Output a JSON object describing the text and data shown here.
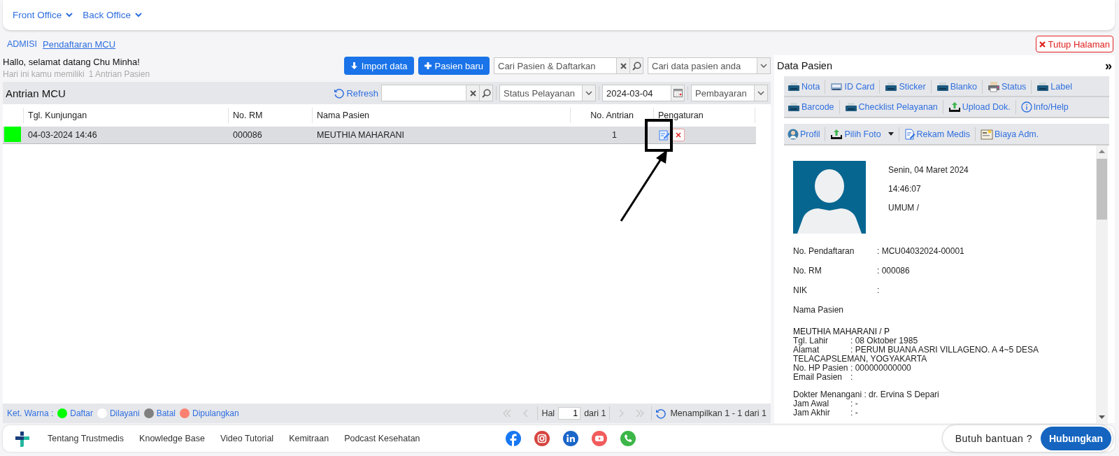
{
  "top_nav": [
    {
      "label": "Front Office"
    },
    {
      "label": "Back Office"
    }
  ],
  "breadcrumb": [
    {
      "label": "ADMISI",
      "selected": false
    },
    {
      "label": "Pendaftaran MCU",
      "selected": true
    }
  ],
  "close_button": "Tutup Halaman",
  "greeting": "Hallo, selamat datang Chu Minha!",
  "queue_summary": {
    "text": "Hari ini kamu memiliki",
    "count": "1 Antrian Pasien"
  },
  "actions": [
    {
      "label": "Import data",
      "kind": "import"
    },
    {
      "label": "Pasien baru",
      "kind": "add"
    }
  ],
  "register_search": {
    "placeholder": "Cari Pasien & Daftarkan"
  },
  "patient_search": {
    "placeholder": "Cari data pasien anda"
  },
  "queue": {
    "title": "Antrian MCU",
    "refresh": "Refresh",
    "status_select": {
      "placeholder": "Status Pelayanan"
    },
    "date": {
      "value": "2024-03-04"
    },
    "payment_select": {
      "placeholder": "Pembayaran"
    },
    "columns": [
      "Tgl. Kunjungan",
      "No. RM",
      "Nama Pasien",
      "No. Antrian",
      "Pengaturan"
    ],
    "rows": [
      {
        "color": "#00ff00",
        "selected": true,
        "cells": [
          "04-03-2024 14:46",
          "000086",
          "MEUTHIA MAHARANI",
          "1"
        ]
      }
    ]
  },
  "legend": {
    "label": "Ket. Warna :",
    "items": [
      {
        "label": "Daftar",
        "color": "#00ff00"
      },
      {
        "label": "Dilayani",
        "color": "#ffffff"
      },
      {
        "label": "Batal",
        "color": "#808080"
      },
      {
        "label": "Dipulangkan",
        "color": "#fa8072"
      }
    ]
  },
  "pagination": {
    "page_label": "Hal",
    "page": "1",
    "total": "dari 1",
    "summary": "Menampilkan 1 - 1 dari 1"
  },
  "patient_panel": {
    "title": "Data Pasien",
    "collapse": "»",
    "toolbar_rows": [
      [
        {
          "label": "Nota",
          "kind": "print"
        },
        {
          "label": "ID Card",
          "kind": "card"
        },
        {
          "label": "Sticker",
          "kind": "print"
        },
        {
          "label": "Blanko",
          "kind": "print"
        },
        {
          "label": "Status",
          "kind": "status"
        },
        {
          "label": "Label",
          "kind": "print"
        }
      ],
      [
        {
          "label": "Barcode",
          "kind": "print"
        },
        {
          "label": "Checklist Pelayanan",
          "kind": "print"
        },
        {
          "label": "Upload Dok.",
          "kind": "upload"
        },
        {
          "label": "Info/Help",
          "kind": "info"
        }
      ]
    ],
    "profile_toolbar": [
      {
        "label": "Profil",
        "kind": "profile"
      },
      {
        "label": "Pilih Foto",
        "kind": "upload",
        "dropdown": true
      },
      {
        "label": "Rekam Medis",
        "kind": "document"
      },
      {
        "label": "Biaya Adm.",
        "kind": "board"
      }
    ],
    "visit": [
      "Senin, 04 Maret 2024",
      "14:46:07",
      "UMUM /"
    ],
    "fields": [
      {
        "label": "No. Pendaftaran",
        "value": ": MCU04032024-00001"
      },
      {
        "label": "No. RM",
        "value": ": 000086"
      },
      {
        "label": "NIK",
        "value": ":"
      },
      {
        "label": "Nama Pasien"
      }
    ],
    "patient_name": "MEUTHIA MAHARANI / P",
    "patient_details": [
      {
        "label": "Tgl. Lahir",
        "value": ": 08 Oktober 1985"
      },
      {
        "label": "Alamat",
        "value": ": PERUM BUANA ASRI VILLAGENO. A 4~5 DESA TELACAPSLEMAN, YOGYAKARTA"
      },
      {
        "label": "No. HP Pasien",
        "value": ": 000000000000"
      },
      {
        "label": "Email Pasien",
        "value": ":"
      }
    ],
    "doctor": {
      "label": "Dokter Menangani",
      "value": ": dr. Ervina S Depari"
    },
    "doctor_details": [
      {
        "label": "Jam Awal",
        "value": ": -"
      },
      {
        "label": "Jam Akhir",
        "value": ": -"
      }
    ]
  },
  "footer": {
    "links": [
      "Tentang Trustmedis",
      "Knowledge Base",
      "Video Tutorial",
      "Kemitraan",
      "Podcast Kesehatan"
    ],
    "social": [
      {
        "kind": "facebook"
      },
      {
        "kind": "instagram"
      },
      {
        "kind": "linkedin"
      },
      {
        "kind": "youtube"
      },
      {
        "kind": "phone"
      }
    ],
    "help_text": "Butuh bantuan ?",
    "help_button": "Hubungkan"
  }
}
